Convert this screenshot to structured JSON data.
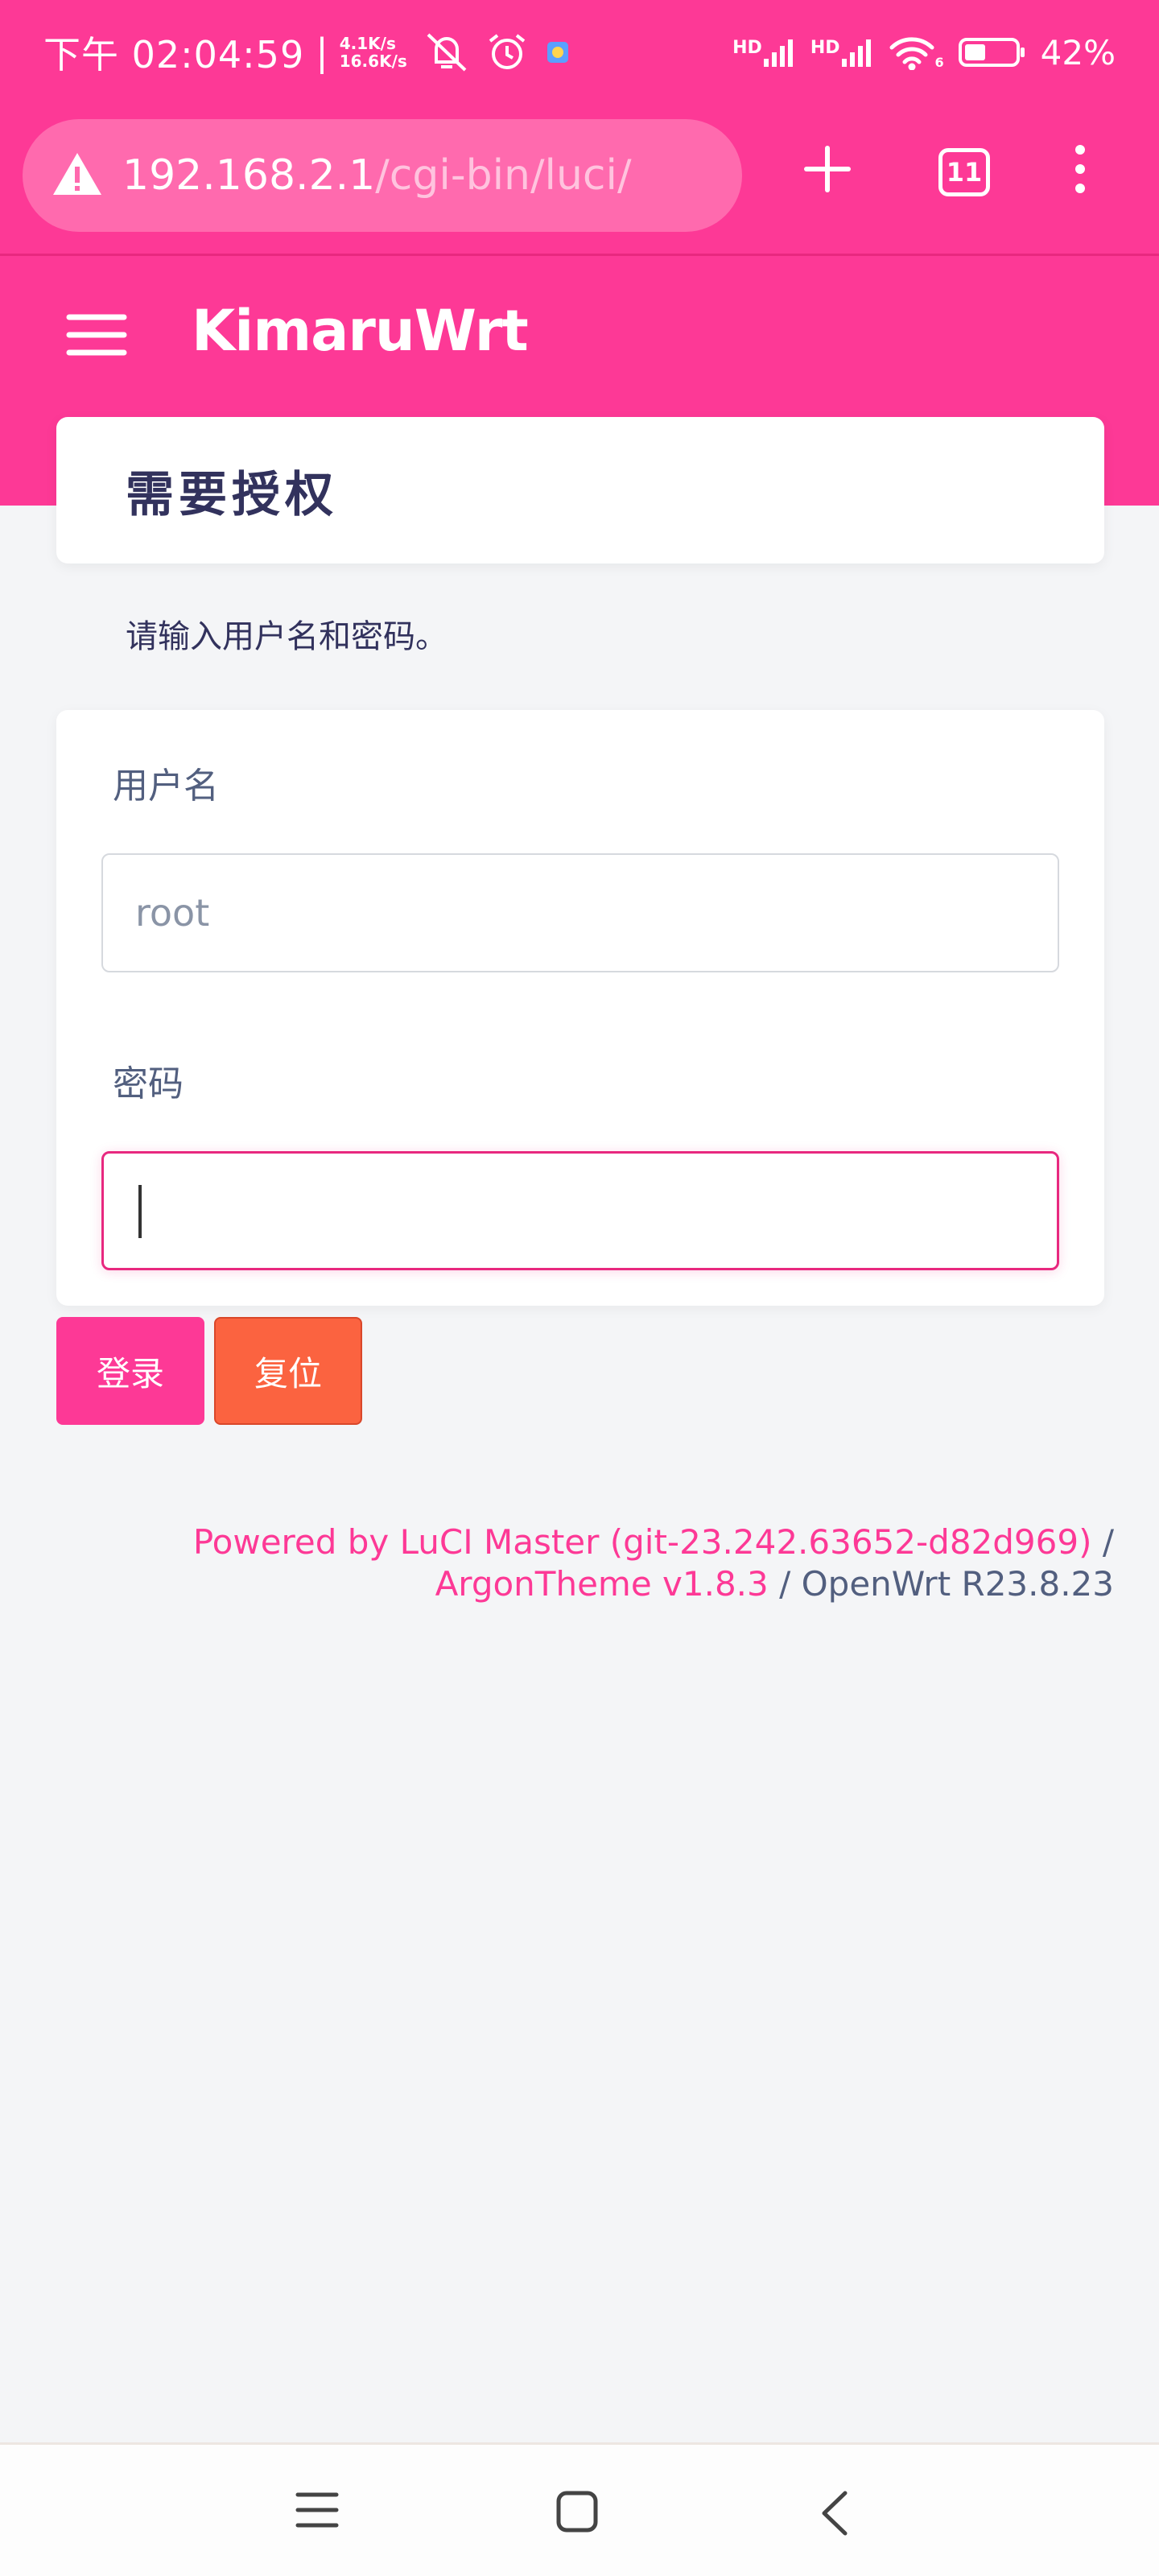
{
  "status_bar": {
    "time": "下午 02:04:59",
    "separator": "|",
    "speed_up": "4.1K/s",
    "speed_down": "16.6K/s",
    "net1": "HD",
    "net2": "HD",
    "wifi_sub": "6",
    "battery_percent": "42%",
    "battery_level": 0.42
  },
  "browser": {
    "url_host": "192.168.2.1",
    "url_path": "/cgi-bin/luci/",
    "tab_count": "11",
    "icons": [
      "warning-icon",
      "plus-icon",
      "tabs-icon",
      "more-vert-icon"
    ]
  },
  "header": {
    "brand": "KimaruWrt"
  },
  "page": {
    "title": "需要授权",
    "hint": "请输入用户名和密码。"
  },
  "form": {
    "username_label": "用户名",
    "username_placeholder": "root",
    "username_value": "",
    "password_label": "密码",
    "password_value": ""
  },
  "buttons": {
    "login": "登录",
    "reset": "复位"
  },
  "footer": {
    "luci_link": "Powered by LuCI Master (git-23.242.63652-d82d969)",
    "sep1": " /",
    "theme_link": "ArgonTheme v1.8.3",
    "rest": " / OpenWrt R23.8.23"
  },
  "colors": {
    "accent": "#fd3996",
    "reset": "#fb6340",
    "text": "#32325d"
  }
}
